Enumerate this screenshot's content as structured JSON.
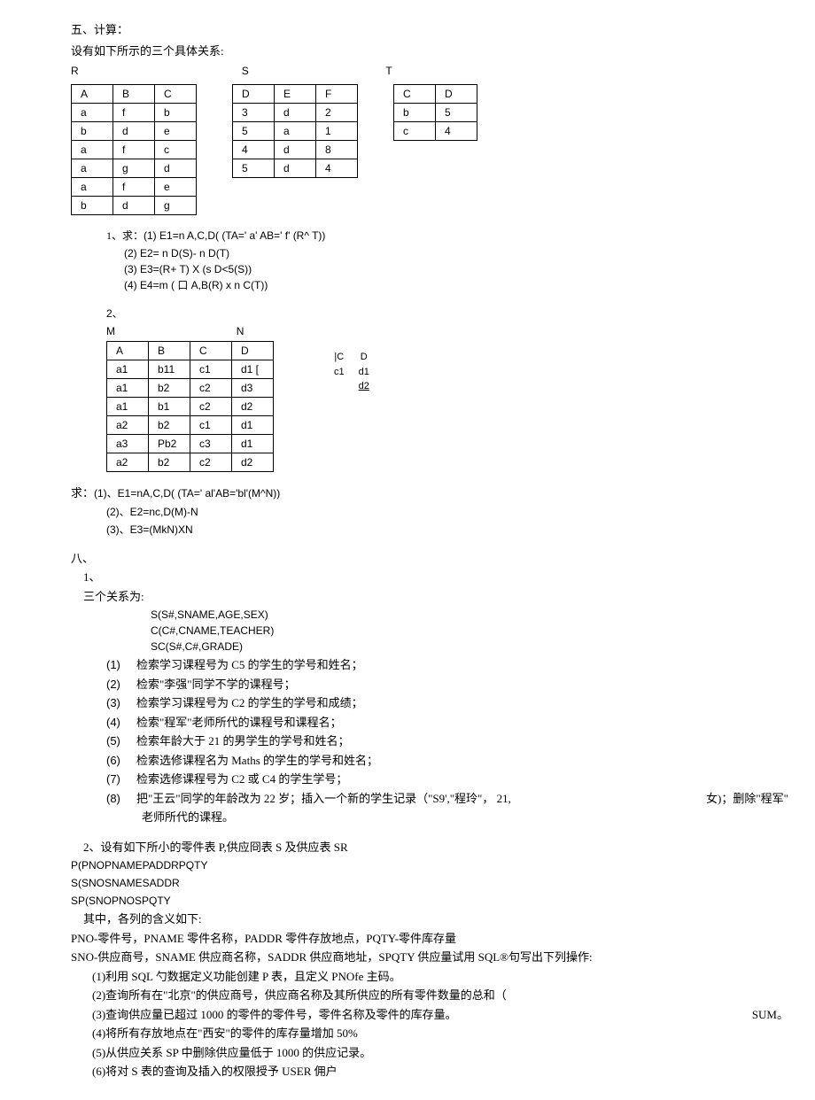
{
  "headings": {
    "h5": "五、计算：",
    "h5_sub": "设有如下所示的三个具体关系:",
    "rLabel": "R",
    "sLabel": "S",
    "tLabel": "T"
  },
  "tableR": {
    "head": [
      "A",
      "B",
      "C"
    ],
    "rows": [
      [
        "a",
        "f",
        "b"
      ],
      [
        "b",
        "d",
        "e"
      ],
      [
        "a",
        "f",
        "c"
      ],
      [
        "a",
        "g",
        "d"
      ],
      [
        "a",
        "f",
        "e"
      ],
      [
        "b",
        "d",
        "g"
      ]
    ]
  },
  "tableS": {
    "head": [
      "D",
      "E",
      "F"
    ],
    "rows": [
      [
        "3",
        "d",
        "2"
      ],
      [
        "5",
        "a",
        "1"
      ],
      [
        "4",
        "d",
        "8"
      ],
      [
        "5",
        "d",
        "4"
      ]
    ]
  },
  "tableT": {
    "head": [
      "C",
      "D"
    ],
    "rows": [
      [
        "b",
        "5"
      ],
      [
        "c",
        "4"
      ]
    ]
  },
  "q1": {
    "lead": "1、求：",
    "e1": "(1) E1=n A,C,D( (TA=' a' AB=' f' (R^ T))",
    "e2": "(2) E2= n D(S)- n D(T)",
    "e3": "(3) E3=(R+ T) X (s D<5(S))",
    "e4": "(4) E4=m ( 口 A,B(R) x n C(T))"
  },
  "q2": {
    "lead": "2、",
    "mLabel": "M",
    "nLabel": "N"
  },
  "tableM": {
    "head": [
      "A",
      "B",
      "C",
      "D"
    ],
    "rows": [
      [
        "a1",
        "b11",
        "c1",
        "d1 ["
      ],
      [
        "a1",
        "b2",
        "c2",
        "d3"
      ],
      [
        "a1",
        "b1",
        "c2",
        "d2"
      ],
      [
        "a2",
        "b2",
        "c1",
        "d1"
      ],
      [
        "a3",
        "Pb2",
        "c3",
        "d1"
      ],
      [
        "a2",
        "b2",
        "c2",
        "d2"
      ]
    ]
  },
  "tableN": {
    "rows": [
      [
        "|C",
        "D"
      ],
      [
        "c1",
        "d1"
      ],
      [
        "",
        "d2"
      ]
    ]
  },
  "q2e": {
    "lead": "求：",
    "e1": "(1)、E1=nA,C,D( (TA=' al'AB='bl'(M^N))",
    "e2": "(2)、E2=nc,D(M)-N",
    "e3": "(3)、E3=(MkN)XN"
  },
  "sec8": {
    "h": "八、",
    "h1": "1、",
    "rel": "三个关系为:",
    "s": "S(S#,SNAME,AGE,SEX)",
    "c": "C(C#,CNAME,TEACHER)",
    "sc": "SC(S#,C#,GRADE)",
    "items": [
      "检索学习课程号为 C5 的学生的学号和姓名；",
      "检索\"李强\"同学不学的课程号；",
      "检索学习课程号为 C2 的学生的学号和成绩；",
      "检索\"程军\"老师所代的课程号和课程名；",
      "检索年龄大于 21 的男学生的学号和姓名；",
      "检索选修课程名为 Maths 的学生的学号和姓名；",
      "检索选修课程号为 C2 或 C4 的学生学号；",
      "把\"王云\"同学的年龄改为 22 岁；插入一个新的学生记录（\"S9',\"程玲\"， 21,"
    ],
    "item8_tail": "老师所代的课程。",
    "right_note": "女)；删除\"程军\""
  },
  "sec8_2": {
    "lead": "2、设有如下所小的零件表 P,供应冏表 S 及供应表 SR",
    "p": "P(PNOPNAMEPADDRPQTY",
    "s": "S(SNOSNAMESADDR",
    "sp": "SP(SNOPNOSPQTY",
    "cols_lead": "其中，各列的含义如下:",
    "pno": "PNO-零件号，PNAME 零件名称，PADDR 零件存放地点，PQTY-零件库存量",
    "sno": "SNO-供应商号，SNAME 供应商名称，SADDR 供应商地址，SPQTY 供应量试用 SQL®句写出下列操作:",
    "ops": [
      "(1)利用 SQL 勺数据定义功能创建 P 表，且定义 PNOfe 主码。",
      "(2)查询所有在\"北京\"的供应商号，供应商名称及其所供应的所有零件数量的总和（",
      "(3)查询供应量已超过 1000 的零件的零件号，零件名称及零件的库存量。",
      "(4)将所有存放地点在\"西安\"的零件的库存量增加 50%",
      "(5)从供应关系 SP 中删除供应量低于 1000 的供应记录。",
      "(6)将对 S 表的查询及插入的权限授予 USER 佣户"
    ],
    "sum": "SUM。"
  }
}
